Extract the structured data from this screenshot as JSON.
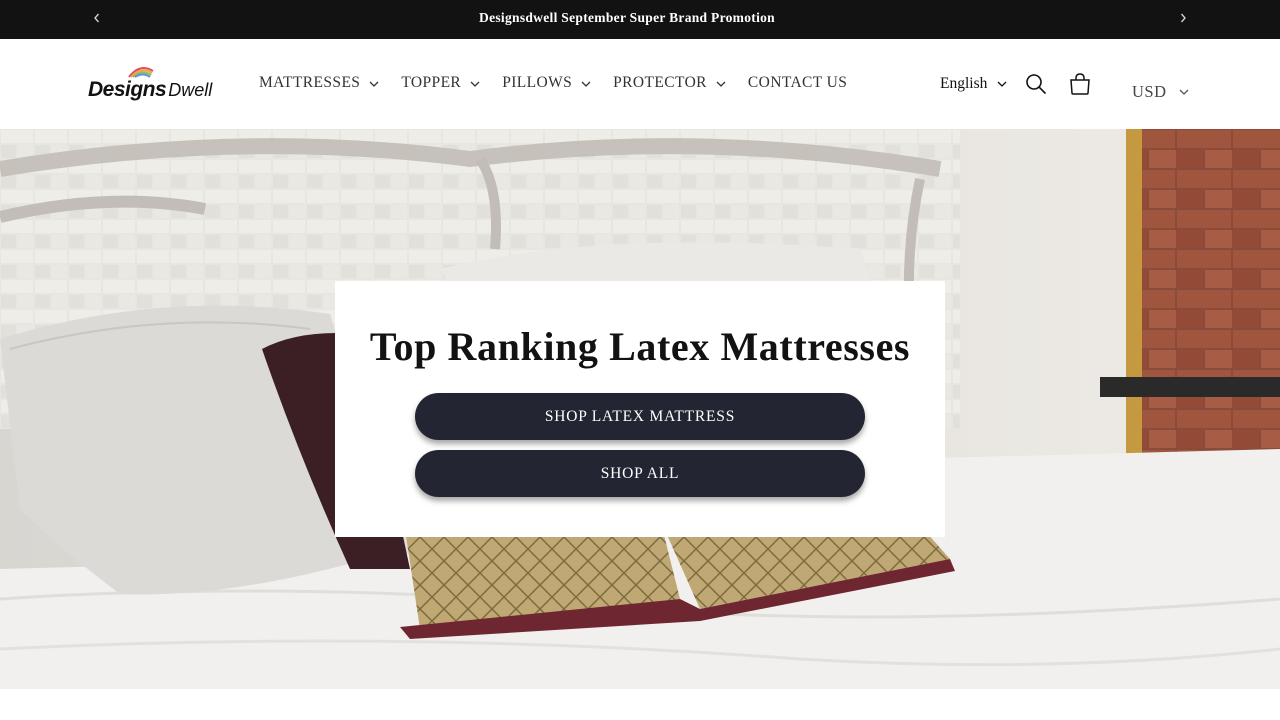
{
  "announcement": {
    "text": "Designsdwell September Super Brand Promotion",
    "prev_icon": "chevron-left-icon",
    "next_icon": "chevron-right-icon"
  },
  "header": {
    "logo": {
      "main": "Designs",
      "sub": "Dwell"
    },
    "nav": [
      {
        "label": "MATTRESSES",
        "has_dropdown": true
      },
      {
        "label": "TOPPER",
        "has_dropdown": true
      },
      {
        "label": "PILLOWS",
        "has_dropdown": true
      },
      {
        "label": "PROTECTOR",
        "has_dropdown": true
      },
      {
        "label": "CONTACT US",
        "has_dropdown": false
      }
    ],
    "language": "English",
    "currency": "USD",
    "icons": [
      "search-icon",
      "cart-icon"
    ]
  },
  "hero": {
    "title": "Top Ranking Latex Mattresses",
    "buttons": [
      {
        "label": "SHOP LATEX MATTRESS"
      },
      {
        "label": "SHOP ALL"
      }
    ]
  },
  "colors": {
    "announcement_bg": "#121212",
    "button_bg": "#232632",
    "text": "#121212"
  }
}
